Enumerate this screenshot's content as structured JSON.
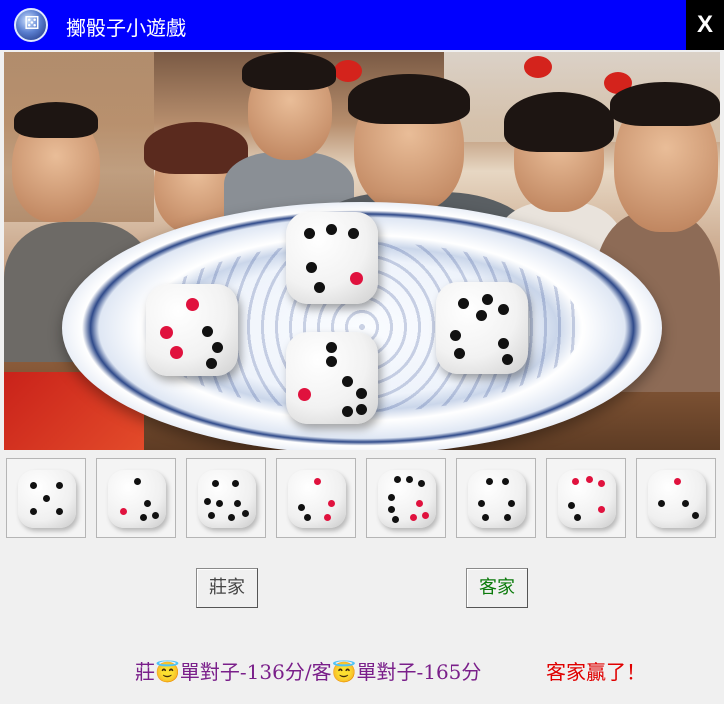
{
  "window": {
    "title": "擲骰子小遊戲",
    "close_label": "X",
    "icon": "dice-globe-icon"
  },
  "scene": {
    "plate_dice_faces": [
      4,
      2,
      5,
      5
    ]
  },
  "tray": {
    "dice_faces": [
      5,
      3,
      6,
      3,
      6,
      5,
      5,
      2
    ]
  },
  "buttons": {
    "dealer_label": "莊家",
    "player_label": "客家"
  },
  "status": {
    "score_text": "莊😇單對子-136分/客😇單對子-165分",
    "result_text": "客家贏了！"
  },
  "colors": {
    "titlebar": "#0000ff",
    "close_bg": "#000000",
    "status_text": "#7a1f8a",
    "result_text": "#e00000",
    "player_button_text": "#0a7a0a",
    "accent_pip": "#e0123e"
  }
}
